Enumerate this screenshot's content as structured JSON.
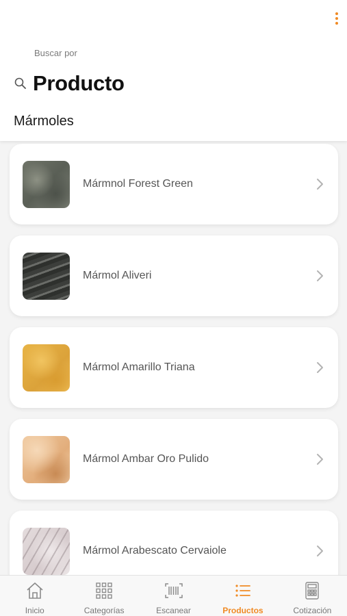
{
  "colors": {
    "accent": "#f08a24",
    "background": "#f4f4f4",
    "card": "#ffffff"
  },
  "header": {
    "menu_icon": "more-vertical-icon",
    "search_hint": "Buscar por",
    "search_icon": "search-icon",
    "search_title": "Producto",
    "section_title": "Mármoles"
  },
  "products": [
    {
      "label": "Mármnol Forest Green"
    },
    {
      "label": "Mármol Aliveri"
    },
    {
      "label": "Mármol Amarillo Triana"
    },
    {
      "label": "Mármol Ambar Oro Pulido"
    },
    {
      "label": "Mármol Arabescato Cervaiole"
    }
  ],
  "tabbar": {
    "tabs": [
      {
        "label": "Inicio",
        "icon": "home-icon",
        "active": false
      },
      {
        "label": "Categorías",
        "icon": "grid-icon",
        "active": false
      },
      {
        "label": "Escanear",
        "icon": "barcode-scan-icon",
        "active": false
      },
      {
        "label": "Productos",
        "icon": "list-icon",
        "active": true
      },
      {
        "label": "Cotización",
        "icon": "calculator-icon",
        "active": false
      }
    ]
  }
}
